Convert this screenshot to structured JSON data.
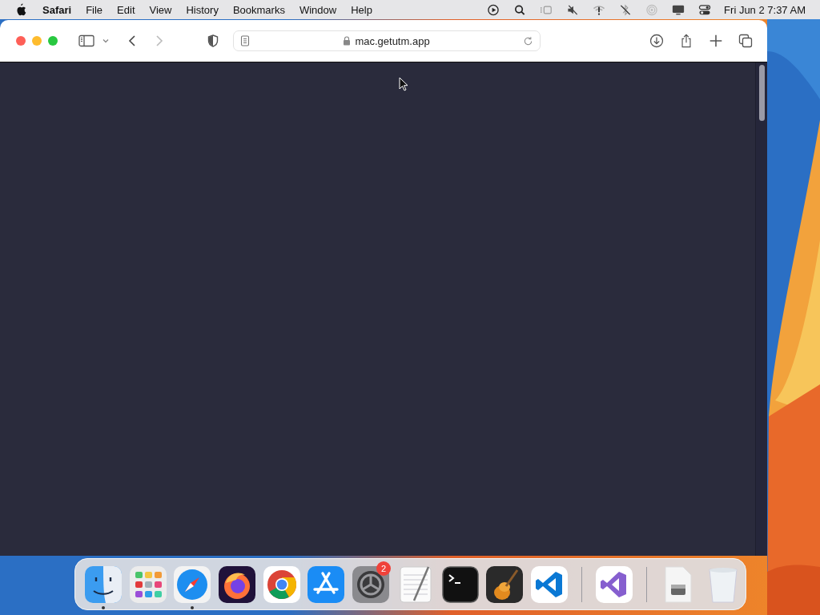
{
  "menu_bar": {
    "app_name": "Safari",
    "menus": [
      "File",
      "Edit",
      "View",
      "History",
      "Bookmarks",
      "Window",
      "Help"
    ],
    "clock": "Fri Jun 2  7:37 AM"
  },
  "browser": {
    "nav": [
      {
        "kind": "back",
        "disabled": false
      },
      {
        "kind": "forward",
        "disabled": true
      }
    ],
    "address": "mac.getutm.app"
  },
  "dock": {
    "sections": [
      [
        {
          "kind": "finder",
          "running": true
        },
        {
          "kind": "launchpad",
          "running": false
        },
        {
          "kind": "safari",
          "running": true
        },
        {
          "kind": "firefox",
          "running": false
        },
        {
          "kind": "chrome",
          "running": false
        },
        {
          "kind": "appstore",
          "running": false
        },
        {
          "kind": "settings",
          "running": false,
          "badge": "2"
        },
        {
          "kind": "textedit",
          "running": false
        },
        {
          "kind": "terminal",
          "running": false
        },
        {
          "kind": "garageband",
          "running": false
        },
        {
          "kind": "vscode",
          "running": false
        }
      ],
      [
        {
          "kind": "visualstudio",
          "running": false
        }
      ],
      [
        {
          "kind": "diskimage",
          "running": false
        },
        {
          "kind": "trash",
          "running": false
        }
      ]
    ]
  }
}
